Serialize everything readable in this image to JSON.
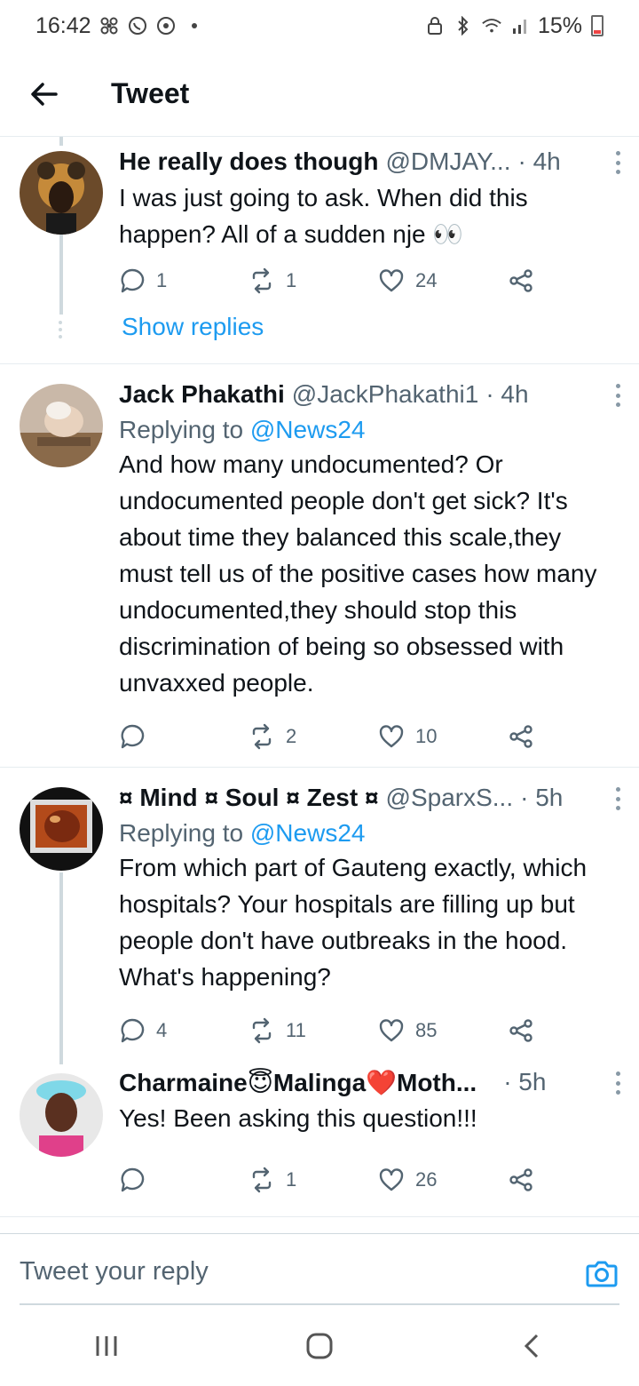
{
  "status_bar": {
    "time": "16:42",
    "battery": "15%"
  },
  "header": {
    "title": "Tweet"
  },
  "tweets": [
    {
      "name": "He really does though",
      "handle": "@DMJAY...",
      "time": "· 4h",
      "body": "I was just going to ask. When did this happen? All of a sudden nje 👀",
      "replies": "1",
      "retweets": "1",
      "likes": "24"
    },
    {
      "name": "Jack Phakathi",
      "handle": "@JackPhakathi1",
      "time": "· 4h",
      "replying_prefix": "Replying to",
      "replying_to": "@News24",
      "body": "And how many undocumented? Or undocumented people don't get sick? It's about time they balanced this scale,they must tell us of the positive cases how many undocumented,they should stop this discrimination of being so obsessed with unvaxxed people.",
      "replies": "",
      "retweets": "2",
      "likes": "10"
    },
    {
      "name": "¤ Mind ¤ Soul ¤ Zest ¤",
      "handle": "@SparxS...",
      "time": "· 5h",
      "replying_prefix": "Replying to",
      "replying_to": "@News24",
      "body": "From which part of Gauteng exactly, which hospitals? Your hospitals are filling up but people don't have outbreaks in the hood. What's happening?",
      "replies": "4",
      "retweets": "11",
      "likes": "85"
    },
    {
      "name": "Charmaine😇Malinga❤️Moth...",
      "handle": "",
      "time": "· 5h",
      "body": "Yes! Been asking this question!!!",
      "replies": "",
      "retweets": "1",
      "likes": "26"
    }
  ],
  "show_replies": "Show replies",
  "reply_bar": {
    "placeholder": "Tweet your reply"
  },
  "icons": {
    "back": "arrow-left-icon",
    "reply": "speech-bubble-icon",
    "retweet": "retweet-icon",
    "like": "heart-icon",
    "share": "share-icon",
    "camera": "camera-icon"
  },
  "colors": {
    "accent": "#1d9bf0",
    "text_primary": "#0f1419",
    "text_secondary": "#536471"
  }
}
